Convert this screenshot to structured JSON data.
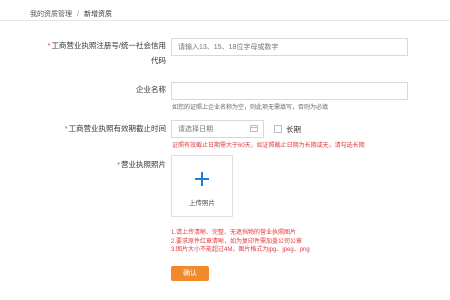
{
  "breadcrumb": {
    "parent": "我的资质管理",
    "separator": "/",
    "current": "新增资质"
  },
  "form": {
    "required_mark": "*",
    "license_no": {
      "label_line1": "工商营业执照注册号/统一社会信用",
      "label_line2": "代码",
      "placeholder": "请输入13、15、18位字母或数字"
    },
    "company_name": {
      "label": "企业名称",
      "value": "",
      "hint": "如您的证照上企业名称为空，则此项无需填写，否则为必填"
    },
    "expiry": {
      "label": "工商营业执照有效期截止时间",
      "placeholder": "请选择日期",
      "checkbox_label": "长期",
      "checked": false,
      "hint": "证照有效截止日期需大于60天，如证照截止日期为长期或无，请勾选长期"
    },
    "photo": {
      "label": "营业执照照片",
      "upload_text": "上传照片"
    },
    "notes": [
      "1.请上传清晰、完整、无遮挡物的营业执照图片",
      "2.要求原件红章清晰，如为复印件需加盖公司公章",
      "3.图片大小不能超过4M，图片格式为jpg、jpeg、png"
    ],
    "submit_label": "确认"
  },
  "colors": {
    "required": "#e4393c",
    "accent_button": "#f08a2b",
    "upload_plus": "#1f7fd8"
  }
}
